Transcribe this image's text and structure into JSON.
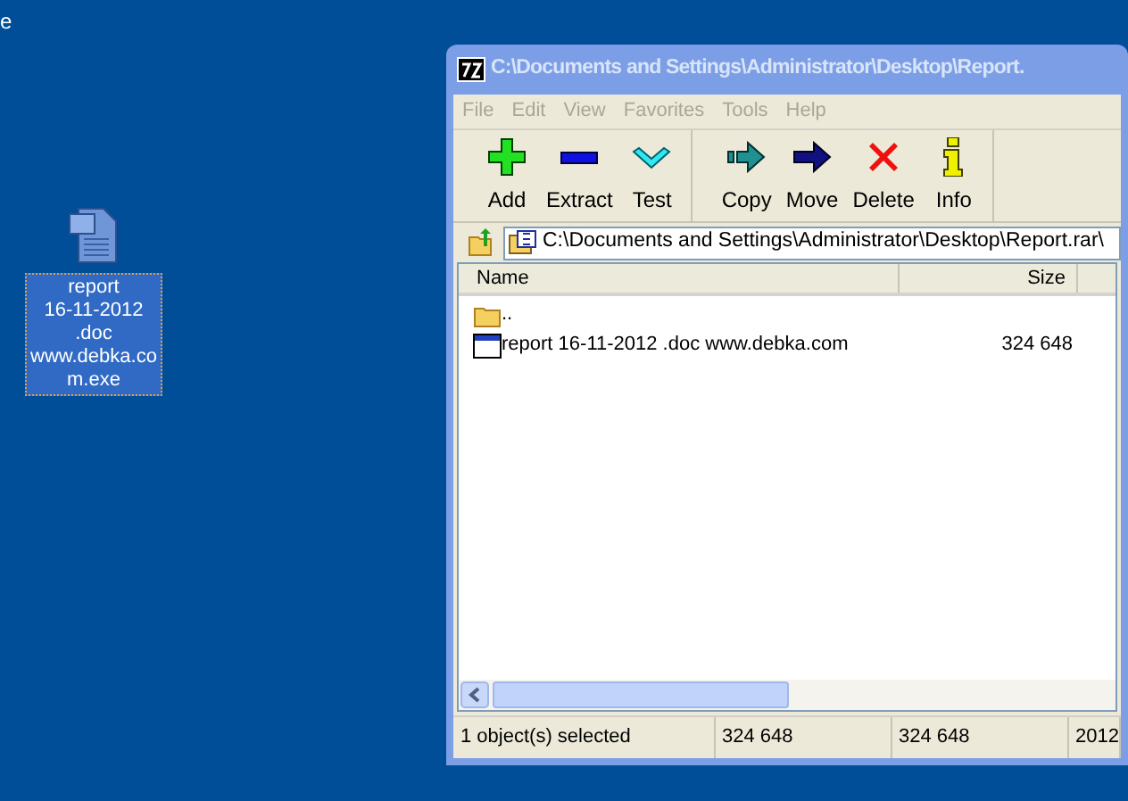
{
  "desktop": {
    "corner_text": "e",
    "icon": {
      "label_lines": [
        "report",
        "16-11-2012",
        ".doc",
        "www.debka.co",
        "m.exe"
      ],
      "selected": true
    }
  },
  "window": {
    "title": "C:\\Documents and Settings\\Administrator\\Desktop\\Report.",
    "active": false,
    "menu": [
      "File",
      "Edit",
      "View",
      "Favorites",
      "Tools",
      "Help"
    ],
    "toolbar_groups": [
      [
        {
          "kind": "add",
          "label": "Add"
        },
        {
          "kind": "extract",
          "label": "Extract"
        },
        {
          "kind": "test",
          "label": "Test"
        }
      ],
      [
        {
          "kind": "copy",
          "label": "Copy"
        },
        {
          "kind": "move",
          "label": "Move"
        },
        {
          "kind": "delete",
          "label": "Delete"
        },
        {
          "kind": "info",
          "label": "Info"
        }
      ]
    ],
    "address": "C:\\Documents and Settings\\Administrator\\Desktop\\Report.rar\\",
    "columns": [
      "Name",
      "Size"
    ],
    "rows": [
      {
        "kind": "folder",
        "name": "..",
        "size": "",
        "selected": false
      },
      {
        "kind": "exe",
        "name": "report 16-11-2012 .doc www.debka.com",
        "size": "324 648",
        "selected": false
      }
    ],
    "status_bar": [
      "1 object(s) selected",
      "324 648",
      "324 648",
      "2012"
    ]
  }
}
